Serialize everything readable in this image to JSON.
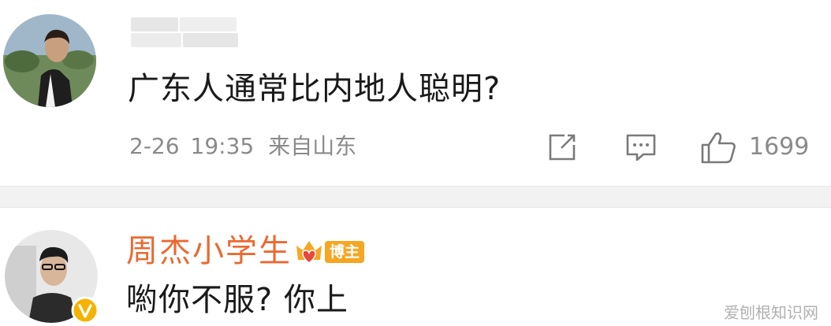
{
  "comments": [
    {
      "text": "广东人通常比内地人聪明?",
      "date": "2-26",
      "time": "19:35",
      "location": "来自山东",
      "like_count": "1699"
    },
    {
      "username": "周杰小学生",
      "badge_label": "博主",
      "text": "喲你不服? 你上"
    }
  ],
  "watermark": "爱刨根知识网",
  "icons": {
    "share": "share-icon",
    "reply": "comment-icon",
    "like": "thumbs-up-icon",
    "verified": "verified-v-icon",
    "badge": "crown-heart-icon"
  },
  "colors": {
    "username": "#e96a32",
    "meta_text": "#8a8a8a",
    "badge_bg": "#f5a623",
    "verified_bg": "#f3b300"
  }
}
